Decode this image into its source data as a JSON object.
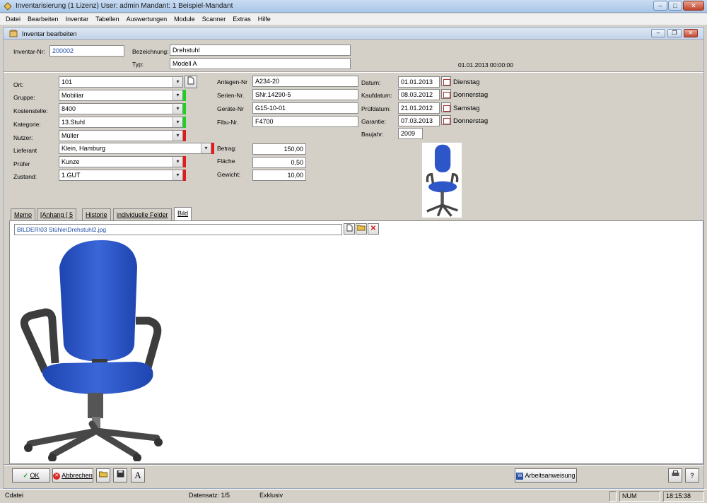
{
  "window": {
    "title": "Inventarisierung  (1 Lizenz)   User: admin   Mandant: 1 Beispiel-Mandant",
    "minimize": "–",
    "maximize": "□",
    "close": "✕"
  },
  "menu": [
    "Datei",
    "Bearbeiten",
    "Inventar",
    "Tabellen",
    "Auswertungen",
    "Module",
    "Scanner",
    "Extras",
    "Hilfe"
  ],
  "child": {
    "title": "Inventar bearbeiten",
    "minimize": "–",
    "restore": "❐",
    "close": "✕"
  },
  "header": {
    "inventar_nr_label": "Inventar-Nr:",
    "inventar_nr": "200002",
    "bezeichnung_label": "Bezeichnung:",
    "bezeichnung": "Drehstuhl",
    "typ_label": "Typ:",
    "typ": "Modell A",
    "timestamp": "01.01.2013 00:00:00"
  },
  "left_fields": [
    {
      "label": "Ort:",
      "value": "101",
      "indicator": "none"
    },
    {
      "label": "Gruppe:",
      "value": "Mobiliar",
      "indicator": "green"
    },
    {
      "label": "Kostenstelle:",
      "value": "8400",
      "indicator": "green"
    },
    {
      "label": "Kategorie:",
      "value": "13.Stuhl",
      "indicator": "green"
    },
    {
      "label": "Nutzer:",
      "value": "Müller",
      "indicator": "red"
    },
    {
      "label": "Lieferant",
      "value": "Klein, Hamburg",
      "indicator": "red"
    },
    {
      "label": "Prüfer",
      "value": "Kunze",
      "indicator": "red"
    },
    {
      "label": "Zustand:",
      "value": "1.GUT",
      "indicator": "red"
    }
  ],
  "mid_fields": [
    {
      "label": "Anlagen-Nr",
      "value": "A234-20"
    },
    {
      "label": "Serien-Nr.",
      "value": "SNr.14290-5"
    },
    {
      "label": "Geräte-Nr",
      "value": "G15-10-01"
    },
    {
      "label": "Fibu-Nr.",
      "value": "F4700"
    }
  ],
  "num_fields": [
    {
      "label": "Betrag:",
      "value": "150,00"
    },
    {
      "label": "Fläche",
      "value": "0,50"
    },
    {
      "label": "Gewicht:",
      "value": "10,00"
    }
  ],
  "date_fields": [
    {
      "label": "Datum:",
      "value": "01.01.2013",
      "weekday": "Dienstag"
    },
    {
      "label": "Kaufdatum:",
      "value": "08.03.2012",
      "weekday": "Donnerstag"
    },
    {
      "label": "Prüfdatum:",
      "value": "21.01.2012",
      "weekday": "Samstag"
    },
    {
      "label": "Garantie:",
      "value": "07.03.2013",
      "weekday": "Donnerstag"
    }
  ],
  "baujahr": {
    "label": "Baujahr:",
    "value": "2009"
  },
  "tabs": [
    "Memo",
    "[Anhang [  5",
    "Historie",
    "individuelle Felder",
    "Bild"
  ],
  "bild": {
    "path": "BILDER\\03 Stühle\\Drehstuhl2.jpg"
  },
  "toolbar": {
    "ok": "OK",
    "abbrechen": "Abbrechen",
    "arbeitsanweisung": "Arbeitsanweisung",
    "font_btn": "A",
    "help_btn": "?"
  },
  "status": {
    "left": "Cdatei",
    "datensatz": "Datensatz: 1/5",
    "mode": "Exklusiv",
    "num": "NUM",
    "time": "18:15:38"
  },
  "colors": {
    "indicator_green": "#19d31e",
    "indicator_red": "#e31b1b",
    "chair_blue": "#2d56c8"
  }
}
